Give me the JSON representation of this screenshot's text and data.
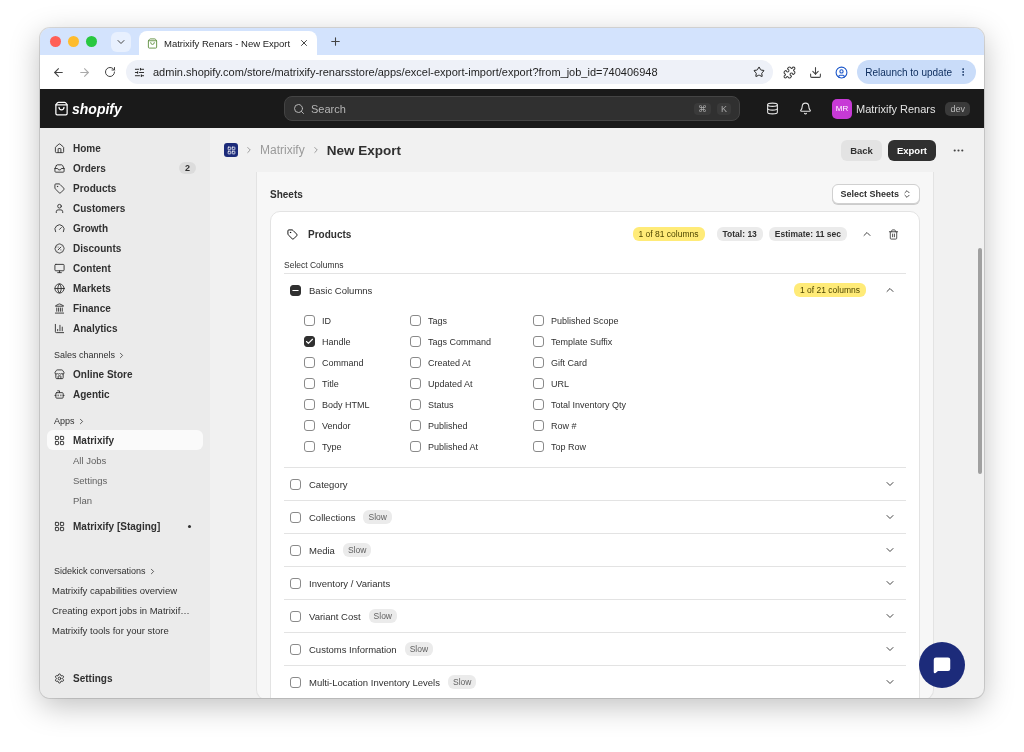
{
  "browser": {
    "tabs": [
      {
        "title": "Matrixify Renars - New Export",
        "selected": true
      }
    ],
    "url": "admin.shopify.com/store/matrixify-renarsstore/apps/excel-export-import/export?from_job_id=740406948",
    "relaunch_button": "Relaunch to update"
  },
  "topbar": {
    "logo": "shopify",
    "search": {
      "placeholder": "Search",
      "keys": [
        "⌘",
        "K"
      ]
    },
    "user": {
      "initials": "MR",
      "name": "Matrixify Renars",
      "badge": "dev"
    }
  },
  "sidebar": {
    "nav": [
      {
        "label": "Home",
        "selected": false
      },
      {
        "label": "Orders",
        "badge": "2",
        "selected": false
      },
      {
        "label": "Products",
        "selected": false
      },
      {
        "label": "Customers",
        "selected": false
      },
      {
        "label": "Growth",
        "selected": false
      },
      {
        "label": "Discounts",
        "selected": false
      },
      {
        "label": "Content",
        "selected": false
      },
      {
        "label": "Markets",
        "selected": false
      },
      {
        "label": "Finance",
        "selected": false
      },
      {
        "label": "Analytics",
        "selected": false
      }
    ],
    "sales_channels": {
      "heading": "Sales channels",
      "items": [
        {
          "label": "Online Store",
          "selected": false
        },
        {
          "label": "Agentic",
          "selected": false
        }
      ]
    },
    "apps": {
      "heading": "Apps",
      "items": [
        {
          "label": "Matrixify",
          "selected": true,
          "children": [
            {
              "label": "All Jobs",
              "selected": false
            },
            {
              "label": "Settings",
              "selected": false
            },
            {
              "label": "Plan",
              "selected": false
            }
          ]
        },
        {
          "label": "Matrixify [Staging]",
          "selected": false
        }
      ]
    },
    "sidekick": {
      "heading": "Sidekick conversations",
      "conversations": [
        "Matrixify capabilities overview",
        "Creating export jobs in Matrixif…",
        "Matrixify tools for your store"
      ]
    },
    "settings": "Settings"
  },
  "page": {
    "breadcrumb": "Matrixify",
    "title": "New Export",
    "actions": [
      {
        "label": "Back",
        "primary": false
      },
      {
        "label": "Export",
        "primary": true
      }
    ]
  },
  "sheets": {
    "title": "Sheets",
    "select_button": "Select Sheets",
    "sheet": {
      "name": "Products",
      "columns_badge": "1 of 81 columns",
      "total": "Total: 13",
      "estimate": "Estimate: 11 sec",
      "expanded": true,
      "select_label": "Select Columns",
      "groups": [
        {
          "label": "Basic Columns",
          "indeterminate": true,
          "badge": "1 of 21 columns",
          "expanded": true,
          "columns": [
            {
              "label": "ID",
              "checked": false
            },
            {
              "label": "Handle",
              "checked": true
            },
            {
              "label": "Command",
              "checked": false
            },
            {
              "label": "Title",
              "checked": false
            },
            {
              "label": "Body HTML",
              "checked": false
            },
            {
              "label": "Vendor",
              "checked": false
            },
            {
              "label": "Type",
              "checked": false
            },
            {
              "label": "Tags",
              "checked": false
            },
            {
              "label": "Tags Command",
              "checked": false
            },
            {
              "label": "Created At",
              "checked": false
            },
            {
              "label": "Updated At",
              "checked": false
            },
            {
              "label": "Status",
              "checked": false
            },
            {
              "label": "Published",
              "checked": false
            },
            {
              "label": "Published At",
              "checked": false
            },
            {
              "label": "Published Scope",
              "checked": false
            },
            {
              "label": "Template Suffix",
              "checked": false
            },
            {
              "label": "Gift Card",
              "checked": false
            },
            {
              "label": "URL",
              "checked": false
            },
            {
              "label": "Total Inventory Qty",
              "checked": false
            },
            {
              "label": "Row #",
              "checked": false
            },
            {
              "label": "Top Row",
              "checked": false
            }
          ]
        },
        {
          "label": "Category",
          "indeterminate": false,
          "expanded": false
        },
        {
          "label": "Collections",
          "indeterminate": false,
          "tag": "Slow",
          "expanded": false
        },
        {
          "label": "Media",
          "indeterminate": false,
          "tag": "Slow",
          "expanded": false
        },
        {
          "label": "Inventory / Variants",
          "indeterminate": false,
          "expanded": false
        },
        {
          "label": "Variant Cost",
          "indeterminate": false,
          "tag": "Slow",
          "expanded": false
        },
        {
          "label": "Customs Information",
          "indeterminate": false,
          "tag": "Slow",
          "expanded": false
        },
        {
          "label": "Multi-Location Inventory Levels",
          "indeterminate": false,
          "tag": "Slow",
          "expanded": false
        }
      ]
    }
  }
}
